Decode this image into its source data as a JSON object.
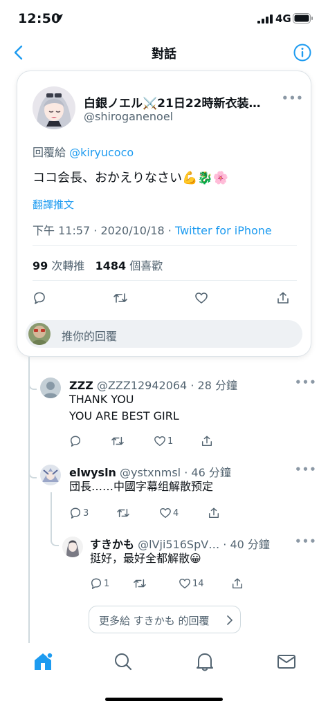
{
  "status": {
    "time": "12:50",
    "network": "4G"
  },
  "nav": {
    "title": "對話"
  },
  "main_tweet": {
    "author_name": "白銀ノエル⚔️21日22時新衣装…",
    "handle": "@shiroganenoel",
    "reply_prefix": "回覆給",
    "reply_to": "@kiryucoco",
    "text": "ココ会長、おかえりなさい💪🐉🌸",
    "translate": "翻譯推文",
    "time": "下午 11:57",
    "date": "2020/10/18",
    "source": "Twitter for iPhone",
    "retweets": "99",
    "retweets_label": "次轉推",
    "likes": "1484",
    "likes_label": "個喜歡",
    "reply_placeholder": "推你的回覆"
  },
  "replies": [
    {
      "name": "ZZZ",
      "handle": "@ZZZ12942064",
      "time": "28 分鐘",
      "lines": [
        "THANK YOU",
        "YOU ARE BEST GIRL"
      ],
      "replies": "",
      "retweets": "",
      "likes": "1"
    },
    {
      "name": "elwysln",
      "handle": "@ystxnmsl",
      "time": "46 分鐘",
      "lines": [
        "団長……中國字幕组解散预定"
      ],
      "replies": "3",
      "retweets": "",
      "likes": "4"
    },
    {
      "name": "すきかも",
      "handle": "@lVji516SpV…",
      "time": "40 分鐘",
      "lines": [
        "挺好，最好全都解散😀"
      ],
      "replies": "1",
      "retweets": "",
      "likes": "14"
    }
  ],
  "more_replies": "更多給 すきかも 的回覆",
  "icons": {
    "accent": "#1d9bf0",
    "tabs": [
      "home-icon",
      "search-icon",
      "notifications-icon",
      "messages-icon"
    ]
  }
}
